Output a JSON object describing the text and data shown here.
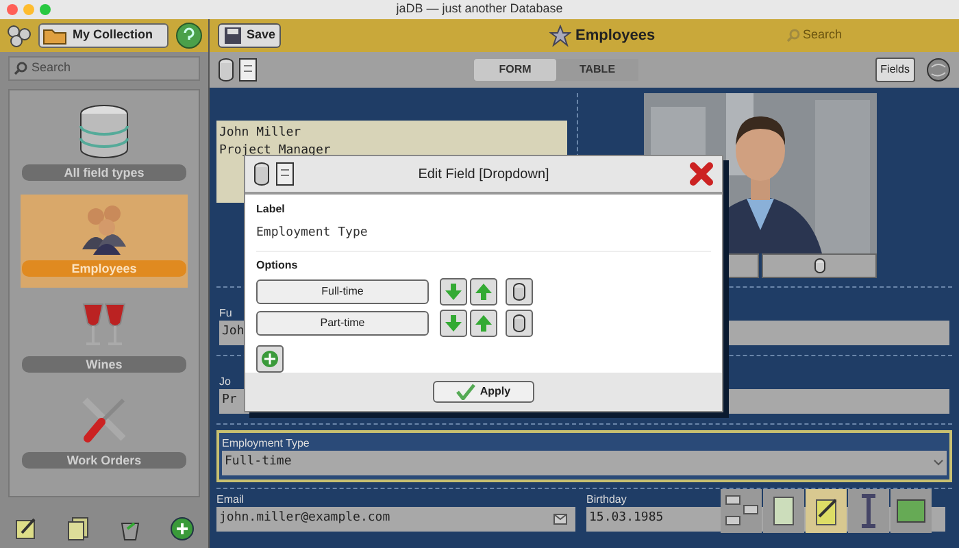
{
  "window": {
    "title": "jaDB — just another Database"
  },
  "sidebar": {
    "collection_button": "My Collection",
    "search": {
      "placeholder": "Search"
    },
    "items": [
      {
        "label": "All field types",
        "selected": false,
        "kind": "database"
      },
      {
        "label": "Employees",
        "selected": true,
        "kind": "people"
      },
      {
        "label": "Wines",
        "selected": false,
        "kind": "wine"
      },
      {
        "label": "Work Orders",
        "selected": false,
        "kind": "tools"
      }
    ]
  },
  "toolbar": {
    "save_button": "Save",
    "title": "Employees",
    "search": {
      "placeholder": "Search"
    },
    "view_tabs": [
      {
        "label": "FORM",
        "selected": true
      },
      {
        "label": "TABLE",
        "selected": false
      }
    ],
    "fields_button": "Fields"
  },
  "form": {
    "summary_lines": [
      "John Miller",
      "Project Manager"
    ],
    "fields": [
      {
        "label": "Fu",
        "value": "Joh",
        "selected": false,
        "kind": "text"
      },
      {
        "label": "Jo",
        "value": "Pr",
        "selected": false,
        "kind": "text"
      },
      {
        "label": "Employment Type",
        "value": "Full-time",
        "selected": true,
        "kind": "dropdown"
      }
    ],
    "bottom_fields": [
      {
        "label": "Email",
        "value": "john.miller@example.com",
        "kind": "email"
      },
      {
        "label": "Birthday",
        "value": "15.03.1985",
        "kind": "date"
      }
    ]
  },
  "dialog": {
    "title": "Edit Field [Dropdown]",
    "label_heading": "Label",
    "label_value": "Employment Type",
    "options_heading": "Options",
    "options": [
      "Full-time",
      "Part-time"
    ],
    "apply_button": "Apply"
  }
}
